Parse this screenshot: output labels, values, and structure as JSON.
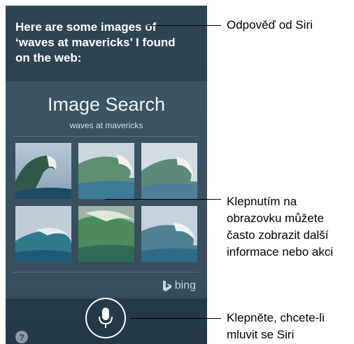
{
  "siri": {
    "response_line1": "Here are some images of",
    "response_line2": "‘waves at mavericks’ I found",
    "response_line3": "on the web:"
  },
  "image_search": {
    "title": "Image Search",
    "query": "waves at mavericks",
    "provider": "bing",
    "provider_icon": "bing-logo-icon"
  },
  "controls": {
    "mic_icon": "microphone-icon",
    "help_label": "?"
  },
  "callouts": {
    "siri_response": "Odpověď od Siri",
    "tap_screen_line1": "Klepnutím na",
    "tap_screen_line2": "obrazovku můžete",
    "tap_screen_line3": "často zobrazit další",
    "tap_screen_line4": "informace nebo akci",
    "tap_mic_line1": "Klepněte, chcete-li",
    "tap_mic_line2": "mluvit se Siri"
  },
  "colors": {
    "background": "#2b414e",
    "text": "#ffffff"
  }
}
